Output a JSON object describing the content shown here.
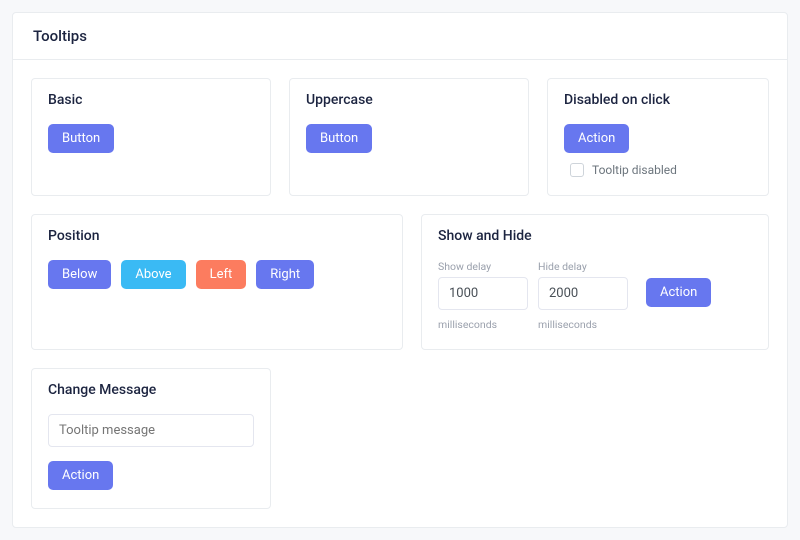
{
  "page": {
    "title": "Tooltips"
  },
  "basic": {
    "title": "Basic",
    "button": "Button"
  },
  "uppercase": {
    "title": "Uppercase",
    "button": "Button"
  },
  "disabled": {
    "title": "Disabled on click",
    "button": "Action",
    "checkbox_label": "Tooltip disabled"
  },
  "position": {
    "title": "Position",
    "below": "Below",
    "above": "Above",
    "left": "Left",
    "right": "Right"
  },
  "showhide": {
    "title": "Show and Hide",
    "show_label": "Show delay",
    "show_value": "1000",
    "show_hint": "milliseconds",
    "hide_label": "Hide delay",
    "hide_value": "2000",
    "hide_hint": "milliseconds",
    "button": "Action"
  },
  "change": {
    "title": "Change Message",
    "placeholder": "Tooltip message",
    "value": "",
    "button": "Action"
  }
}
